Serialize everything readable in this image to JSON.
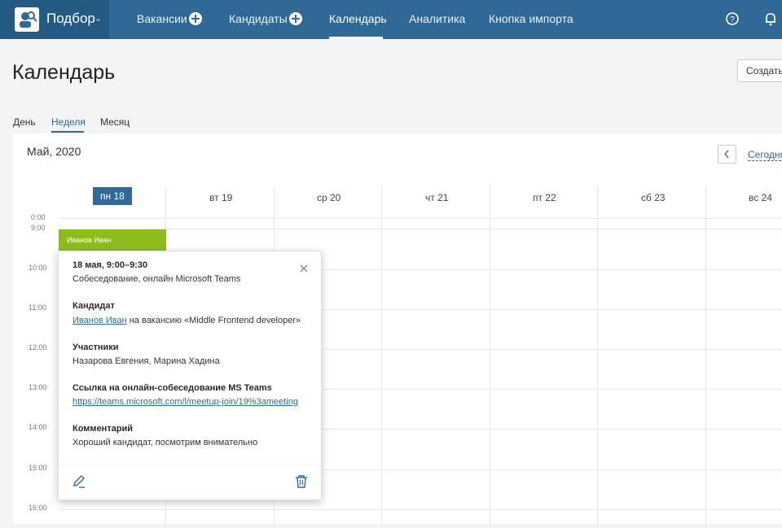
{
  "nav": {
    "brand": "Подбор",
    "items": [
      {
        "label": "Вакансии"
      },
      {
        "label": "Кандидаты"
      },
      {
        "label": "Календарь"
      },
      {
        "label": "Аналитика"
      },
      {
        "label": "Кнопка импорта"
      }
    ],
    "active": "Календарь"
  },
  "page": {
    "title": "Календарь",
    "create_label": "Создать"
  },
  "views": {
    "day": "День",
    "week": "Неделя",
    "month": "Месяц",
    "active": "Неделя"
  },
  "calendar": {
    "month_label": "Май, 2020",
    "today_label": "Сегодня",
    "days": [
      "пн 18",
      "вт 19",
      "ср 20",
      "чт 21",
      "пт 22",
      "сб 23",
      "вс 24"
    ],
    "active_day": "пн 18",
    "times": [
      "0:00",
      "9:00",
      "10:00",
      "11:00",
      "12:00",
      "13:00",
      "14:00",
      "15:00",
      "16:00"
    ]
  },
  "event": {
    "label": "Иванов Иван"
  },
  "popover": {
    "datetime": "18 мая, 9:00–9:30",
    "event_type": "Собеседование, онлайн Microsoft Teams",
    "candidate_heading": "Кандидат",
    "candidate_name": "Иванов Иван",
    "candidate_suffix": "на вакансию «Middle Frontend developer»",
    "participants_heading": "Участники",
    "participants": "Назарова Евгения, Марина Хадина",
    "link_heading": "Ссылка на онлайн-собеседование MS Teams",
    "link": "https://teams.microsoft.com/l/meetup-join/19%3ameeting",
    "comment_heading": "Комментарий",
    "comment": "Хороший кандидат, посмотрим внимательно"
  },
  "colors": {
    "nav_bg": "#2f6995",
    "accent": "#2f6995",
    "event": "#8ebc1c"
  }
}
